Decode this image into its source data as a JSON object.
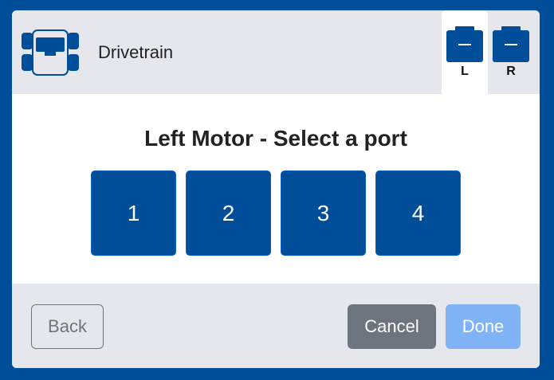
{
  "header": {
    "title": "Drivetrain",
    "icon": "drivetrain-icon",
    "tabs": [
      {
        "label": "L",
        "icon": "motor-icon",
        "active": true
      },
      {
        "label": "R",
        "icon": "motor-icon",
        "active": false
      }
    ]
  },
  "main": {
    "prompt": "Left Motor - Select a port",
    "ports": [
      "1",
      "2",
      "3",
      "4"
    ]
  },
  "footer": {
    "back_label": "Back",
    "cancel_label": "Cancel",
    "done_label": "Done"
  },
  "colors": {
    "brand_blue": "#004d99",
    "dialog_bg": "#e6e7ec",
    "cancel_gray": "#6c757d",
    "done_disabled": "#80b3f5"
  }
}
